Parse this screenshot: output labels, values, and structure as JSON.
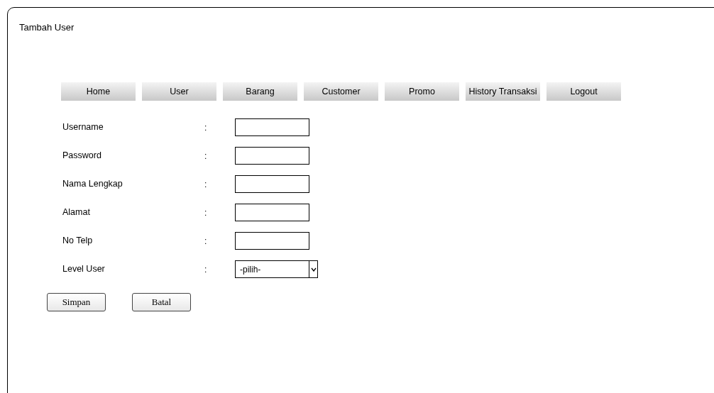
{
  "window": {
    "title": "Tambah User"
  },
  "nav": [
    {
      "label": "Home"
    },
    {
      "label": "User"
    },
    {
      "label": "Barang"
    },
    {
      "label": "Customer"
    },
    {
      "label": "Promo"
    },
    {
      "label": "History Transaksi"
    },
    {
      "label": "Logout"
    }
  ],
  "form": {
    "separator": ":",
    "fields": [
      {
        "kind": "text",
        "label": "Username"
      },
      {
        "kind": "text",
        "label": "Password"
      },
      {
        "kind": "text",
        "label": "Nama Lengkap"
      },
      {
        "kind": "text",
        "label": "Alamat"
      },
      {
        "kind": "text",
        "label": "No Telp"
      },
      {
        "kind": "select",
        "label": "Level User",
        "value": "-pilih-"
      }
    ]
  },
  "buttons": [
    {
      "label": "Simpan"
    },
    {
      "label": "Batal"
    }
  ]
}
